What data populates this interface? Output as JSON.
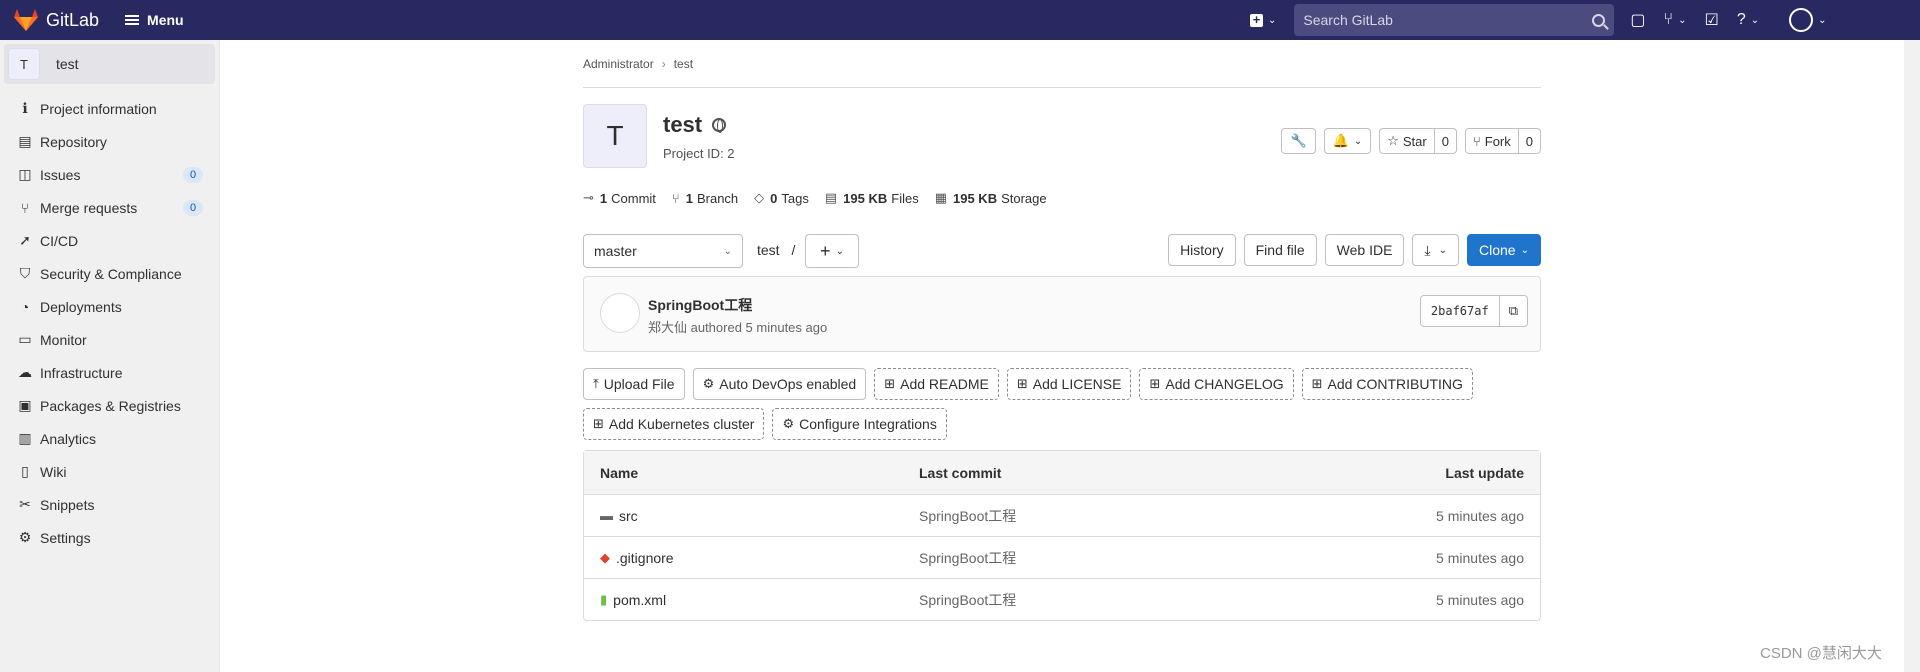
{
  "topbar": {
    "brand": "GitLab",
    "menu_label": "Menu",
    "search_placeholder": "Search GitLab"
  },
  "sidebar": {
    "project_initial": "T",
    "project_name": "test",
    "items": [
      {
        "label": "Project information",
        "icon": "info-icon"
      },
      {
        "label": "Repository",
        "icon": "doc-icon"
      },
      {
        "label": "Issues",
        "icon": "issues-icon",
        "badge": "0"
      },
      {
        "label": "Merge requests",
        "icon": "merge-icon",
        "badge": "0"
      },
      {
        "label": "CI/CD",
        "icon": "rocket-icon"
      },
      {
        "label": "Security & Compliance",
        "icon": "shield-icon"
      },
      {
        "label": "Deployments",
        "icon": "deploy-icon"
      },
      {
        "label": "Monitor",
        "icon": "monitor-icon"
      },
      {
        "label": "Infrastructure",
        "icon": "cloud-icon"
      },
      {
        "label": "Packages & Registries",
        "icon": "package-icon"
      },
      {
        "label": "Analytics",
        "icon": "chart-icon"
      },
      {
        "label": "Wiki",
        "icon": "book-icon"
      },
      {
        "label": "Snippets",
        "icon": "scissors-icon"
      },
      {
        "label": "Settings",
        "icon": "gear-icon"
      }
    ]
  },
  "breadcrumb": {
    "items": [
      "Administrator",
      "test"
    ]
  },
  "project": {
    "initial": "T",
    "title": "test",
    "id_text": "Project ID: 2",
    "star_label": "Star",
    "star_count": "0",
    "fork_label": "Fork",
    "fork_count": "0"
  },
  "stats": [
    {
      "value": "1",
      "label": "Commit",
      "icon": "commit-icon"
    },
    {
      "value": "1",
      "label": "Branch",
      "icon": "branch-icon"
    },
    {
      "value": "0",
      "label": "Tags",
      "icon": "tag-icon"
    },
    {
      "value": "195 KB",
      "label": "Files",
      "icon": "file-icon"
    },
    {
      "value": "195 KB",
      "label": "Storage",
      "icon": "storage-icon"
    }
  ],
  "tree": {
    "branch": "master",
    "path": "test",
    "path_sep": "/",
    "history": "History",
    "find_file": "Find file",
    "web_ide": "Web IDE",
    "clone": "Clone"
  },
  "commit": {
    "title": "SpringBoot工程",
    "meta": "郑大仙 authored 5 minutes ago",
    "sha": "2baf67af"
  },
  "quick_actions": [
    {
      "label": "Upload File",
      "icon": "upload-icon",
      "dashed": false
    },
    {
      "label": "Auto DevOps enabled",
      "icon": "gear-icon",
      "dashed": false
    },
    {
      "label": "Add README",
      "icon": "plus-square-icon",
      "dashed": true
    },
    {
      "label": "Add LICENSE",
      "icon": "plus-square-icon",
      "dashed": true
    },
    {
      "label": "Add CHANGELOG",
      "icon": "plus-square-icon",
      "dashed": true
    },
    {
      "label": "Add CONTRIBUTING",
      "icon": "plus-square-icon",
      "dashed": true
    },
    {
      "label": "Add Kubernetes cluster",
      "icon": "plus-square-icon",
      "dashed": true
    },
    {
      "label": "Configure Integrations",
      "icon": "gear-icon",
      "dashed": true
    }
  ],
  "files": {
    "headers": {
      "name": "Name",
      "commit": "Last commit",
      "update": "Last update"
    },
    "rows": [
      {
        "name": "src",
        "icon": "folder-icon",
        "commit": "SpringBoot工程",
        "update": "5 minutes ago"
      },
      {
        "name": ".gitignore",
        "icon": "git-icon",
        "commit": "SpringBoot工程",
        "update": "5 minutes ago"
      },
      {
        "name": "pom.xml",
        "icon": "xml-file-icon",
        "commit": "SpringBoot工程",
        "update": "5 minutes ago"
      }
    ]
  },
  "watermark": "CSDN @慧闲大大"
}
